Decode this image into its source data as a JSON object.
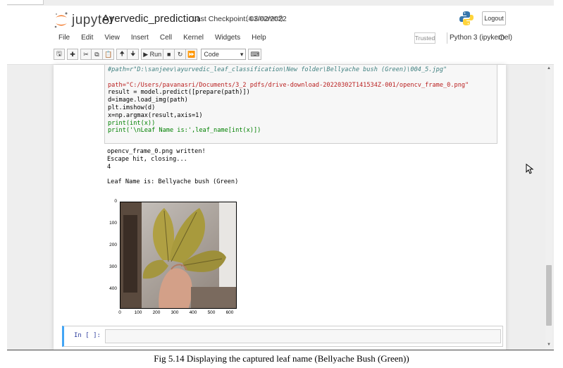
{
  "header": {
    "logo_text": "jupyter",
    "notebook_title": "Ayervedic_prediction",
    "checkpoint": "Last Checkpoint: 03/02/2022",
    "autosave": "(autosaved)",
    "logout_label": "Logout"
  },
  "menu": [
    "File",
    "Edit",
    "View",
    "Insert",
    "Cell",
    "Kernel",
    "Widgets",
    "Help"
  ],
  "trusted_label": "Trusted",
  "kernel_label": "Python 3 (ipykernel)",
  "toolbar": {
    "run_label": "Run",
    "cell_type": "Code"
  },
  "code_cell": {
    "lines": [
      "#path=r\"D:\\sanjeev\\ayurvedic_leaf_classification\\New folder\\Bellyache bush (Green)\\004_5.jpg\"",
      "",
      "path=\"C:/Users/pavanasri/Documents/3_2 pdfs/drive-download-20220302T141534Z-001/opencv_frame_0.png\"",
      "result = model.predict([prepare(path)])",
      "d=image.load_img(path)",
      "plt.imshow(d)",
      "x=np.argmax(result,axis=1)",
      "print(int(x))",
      "print('\\nLeaf Name is:',leaf_name[int(x)])"
    ]
  },
  "output": {
    "lines": [
      "opencv_frame_0.png written!",
      "Escape hit, closing...",
      "4",
      "",
      "Leaf Name is: Bellyache bush (Green)"
    ]
  },
  "plot": {
    "y_ticks": [
      "0",
      "100",
      "200",
      "300",
      "400"
    ],
    "x_ticks": [
      "0",
      "100",
      "200",
      "300",
      "400",
      "500",
      "600"
    ]
  },
  "new_cell": {
    "prompt": "In [ ]:"
  },
  "caption": "Fig 5.14 Displaying the captured leaf name (Bellyache Bush (Green))"
}
